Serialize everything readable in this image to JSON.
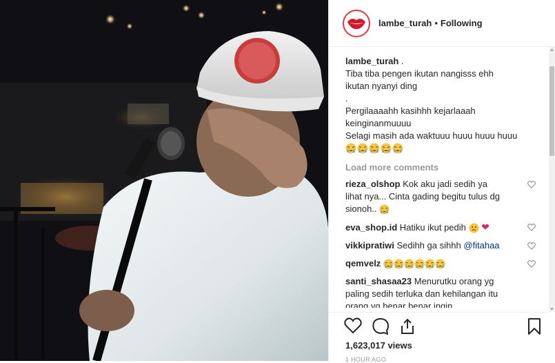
{
  "header": {
    "username": "lambe_turah",
    "separator": "•",
    "follow_status": "Following"
  },
  "caption": {
    "username": "lambe_turah",
    "suffix": " .",
    "lines": [
      "Tiba tiba pengen ikutan nangisss ehh",
      "ikutan nyanyi ding",
      ".",
      "Pergilaaaahh kasihhh kejarlaaah",
      "keinginanmuuuu",
      "Selagi masih ada waktuuu huuu huuu huuu"
    ],
    "emoji_count": 5
  },
  "load_more": "Load more comments",
  "comments": [
    {
      "username": "rieza_olshop",
      "line1": "Kok aku jadi sedih ya",
      "line2": "lihat nya... Cinta gading begitu tulus dg",
      "line3": "sionoh.."
    },
    {
      "username": "eva_shop.id",
      "text": "Hatiku ikut pedih"
    },
    {
      "username": "vikkipratiwi",
      "text": "Sedihh ga sihhh",
      "mention": "@fitahaa"
    },
    {
      "username": "qemvelz",
      "emoji_count": 6
    },
    {
      "username": "santi_shasaa23",
      "line1": "Menurutku orang yg",
      "line2": "paling sedih terluka dan kehilangan itu",
      "line3": "orang yg benar benar ingin"
    }
  ],
  "stats": {
    "views": "1,623,017 views",
    "time": "1 HOUR AGO"
  },
  "icons": {
    "like": "heart-icon",
    "comment": "comment-icon",
    "share": "share-icon",
    "save": "bookmark-icon"
  },
  "colors": {
    "avatar_ring": "#e7343f",
    "mention": "#003569",
    "muted": "#999999",
    "heart_red": "#e0245e"
  }
}
